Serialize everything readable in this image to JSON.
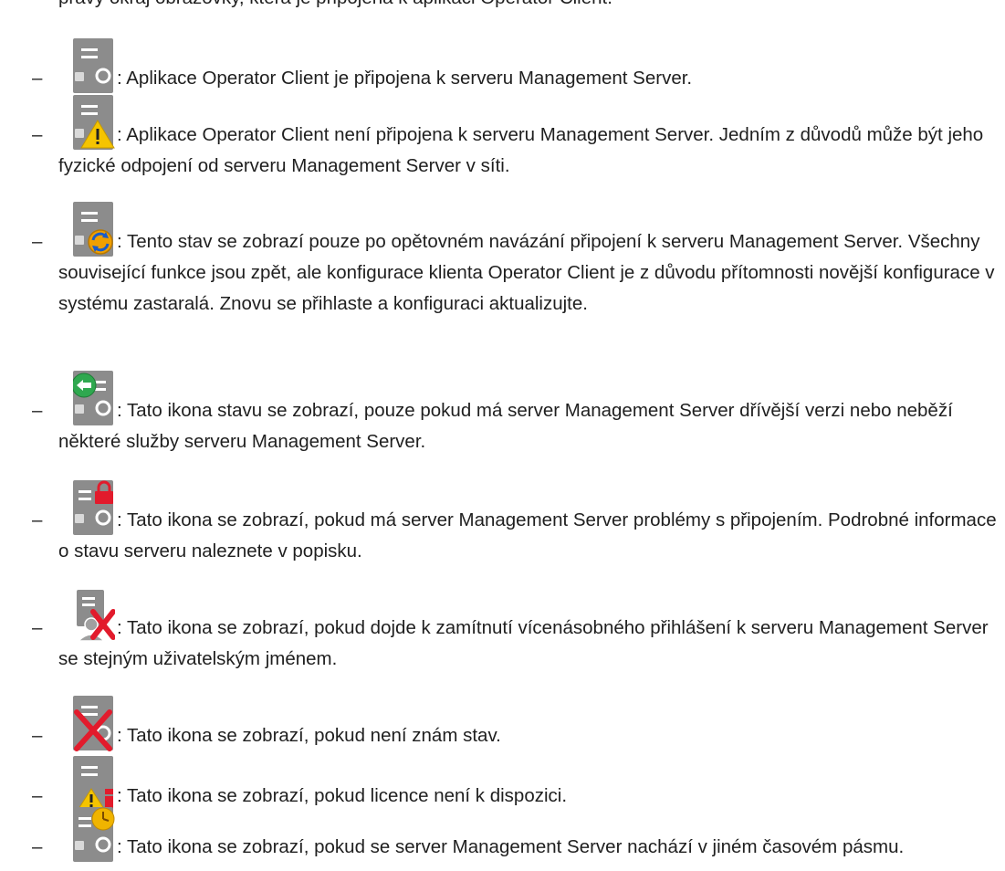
{
  "intro": "pravý okraj obrazovky, která je připojena k aplikaci Operator Client.",
  "bullet": "–",
  "items": [
    {
      "icon": "server-connected-icon",
      "text": ": Aplikace Operator Client je připojena k serveru Management Server."
    },
    {
      "icon": "server-warning-icon",
      "text": ": Aplikace Operator Client není připojena k serveru Management Server. Jedním z důvodů může být jeho fyzické odpojení od serveru Management Server v síti."
    },
    {
      "icon": "server-reconnected-icon",
      "text": ": Tento stav se zobrazí pouze po opětovném navázání připojení k serveru Management Server. Všechny související funkce jsou zpět, ale konfigurace klienta Operator Client je z důvodu přítomnosti novější konfigurace v systému zastaralá. Znovu se přihlaste a konfiguraci aktualizujte."
    },
    {
      "icon": "server-older-version-icon",
      "text": ": Tato ikona stavu se zobrazí, pouze pokud má server Management Server dřívější verzi nebo neběží některé služby serveru Management Server."
    },
    {
      "icon": "server-locked-icon",
      "text": ": Tato ikona se zobrazí, pokud má server Management Server problémy s připojením. Podrobné informace o stavu serveru naleznete v popisku."
    },
    {
      "icon": "server-user-rejected-icon",
      "text": ": Tato ikona se zobrazí, pokud dojde k zamítnutí vícenásobného přihlášení k serveru Management Server se stejným uživatelským jménem."
    },
    {
      "icon": "server-unknown-icon",
      "text": ": Tato ikona se zobrazí, pokud není znám stav."
    },
    {
      "icon": "server-no-license-icon",
      "text": ": Tato ikona se zobrazí, pokud licence není k dispozici."
    },
    {
      "icon": "server-timezone-icon",
      "text": ": Tato ikona se zobrazí, pokud se server Management Server nachází v jiném časovém pásmu."
    }
  ],
  "colors": {
    "text": "#1f1f1f",
    "server_body": "#8c8c8c",
    "server_light": "#b4b4b4",
    "warning": "#f5c400",
    "green": "#2fa84f",
    "red": "#e21b2c",
    "orange": "#f0a000"
  }
}
